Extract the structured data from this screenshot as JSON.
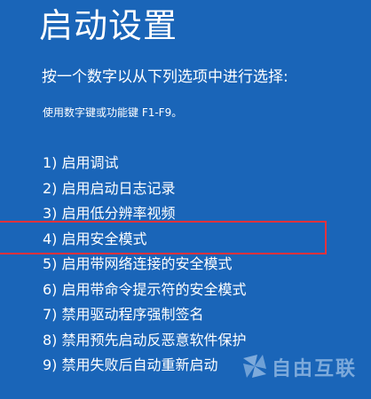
{
  "screen": {
    "title": "启动设置",
    "instruction": "按一个数字以从下列选项中进行选择:",
    "hint": "使用数字键或功能键 F1-F9。",
    "options": [
      {
        "label": "1) 启用调试"
      },
      {
        "label": "2) 启用启动日志记录"
      },
      {
        "label": "3) 启用低分辨率视频"
      },
      {
        "label": "4) 启用安全模式"
      },
      {
        "label": "5) 启用带网络连接的安全模式"
      },
      {
        "label": "6) 启用带命令提示符的安全模式"
      },
      {
        "label": "7) 禁用驱动程序强制签名"
      },
      {
        "label": "8) 禁用预先启动反恶意软件保护"
      },
      {
        "label": "9) 禁用失败后自动重新启动"
      }
    ],
    "highlighted_option": "4) 启用安全模式"
  },
  "watermark": {
    "text": "自由互联",
    "icon": "logo-icon"
  },
  "colors": {
    "background": "#1a65b8",
    "text": "#ffffff",
    "highlight_border": "#e8323c"
  }
}
